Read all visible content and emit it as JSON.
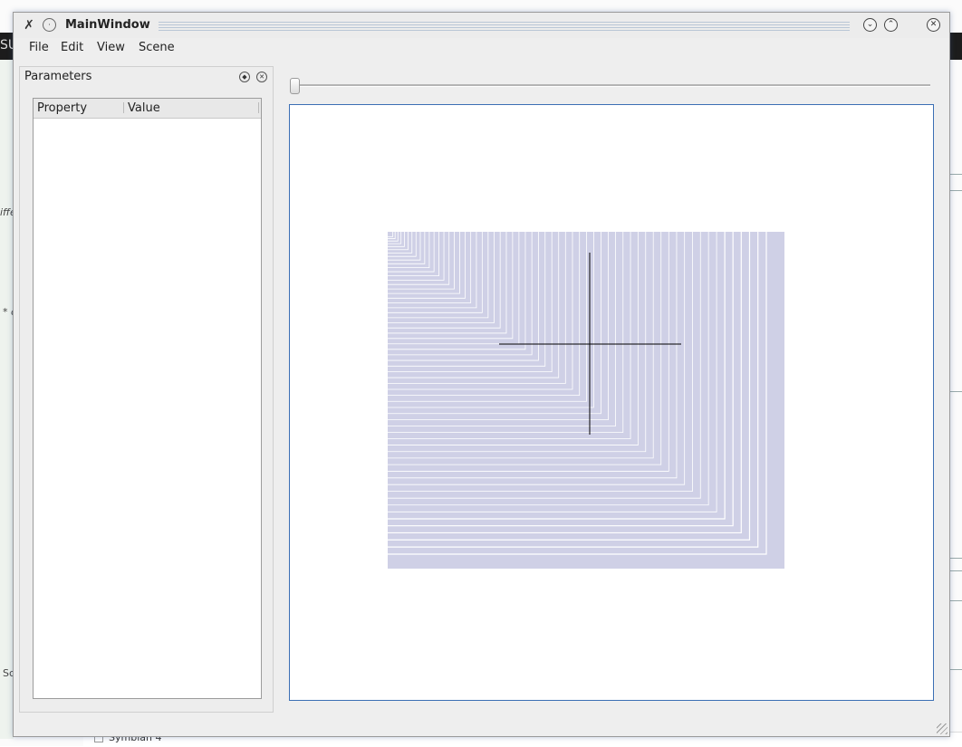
{
  "window": {
    "title": "MainWindow"
  },
  "menubar": {
    "items": [
      "File",
      "Edit",
      "View",
      "Scene"
    ]
  },
  "dock": {
    "title": "Parameters",
    "columns": [
      "Property",
      "Value"
    ]
  },
  "slider": {
    "value": 0
  },
  "scene": {
    "fill_color": "#cfd0e6",
    "line_color": "#ffffff",
    "axis_color": "#000000"
  },
  "background": {
    "left_fragments": [
      "iffe",
      "* c",
      "Sc"
    ],
    "top_fragment": "SU",
    "bottom_label": "Symbian 4"
  },
  "colors": {
    "view_border": "#3b6fb4",
    "window_bg": "#eeeeee"
  }
}
